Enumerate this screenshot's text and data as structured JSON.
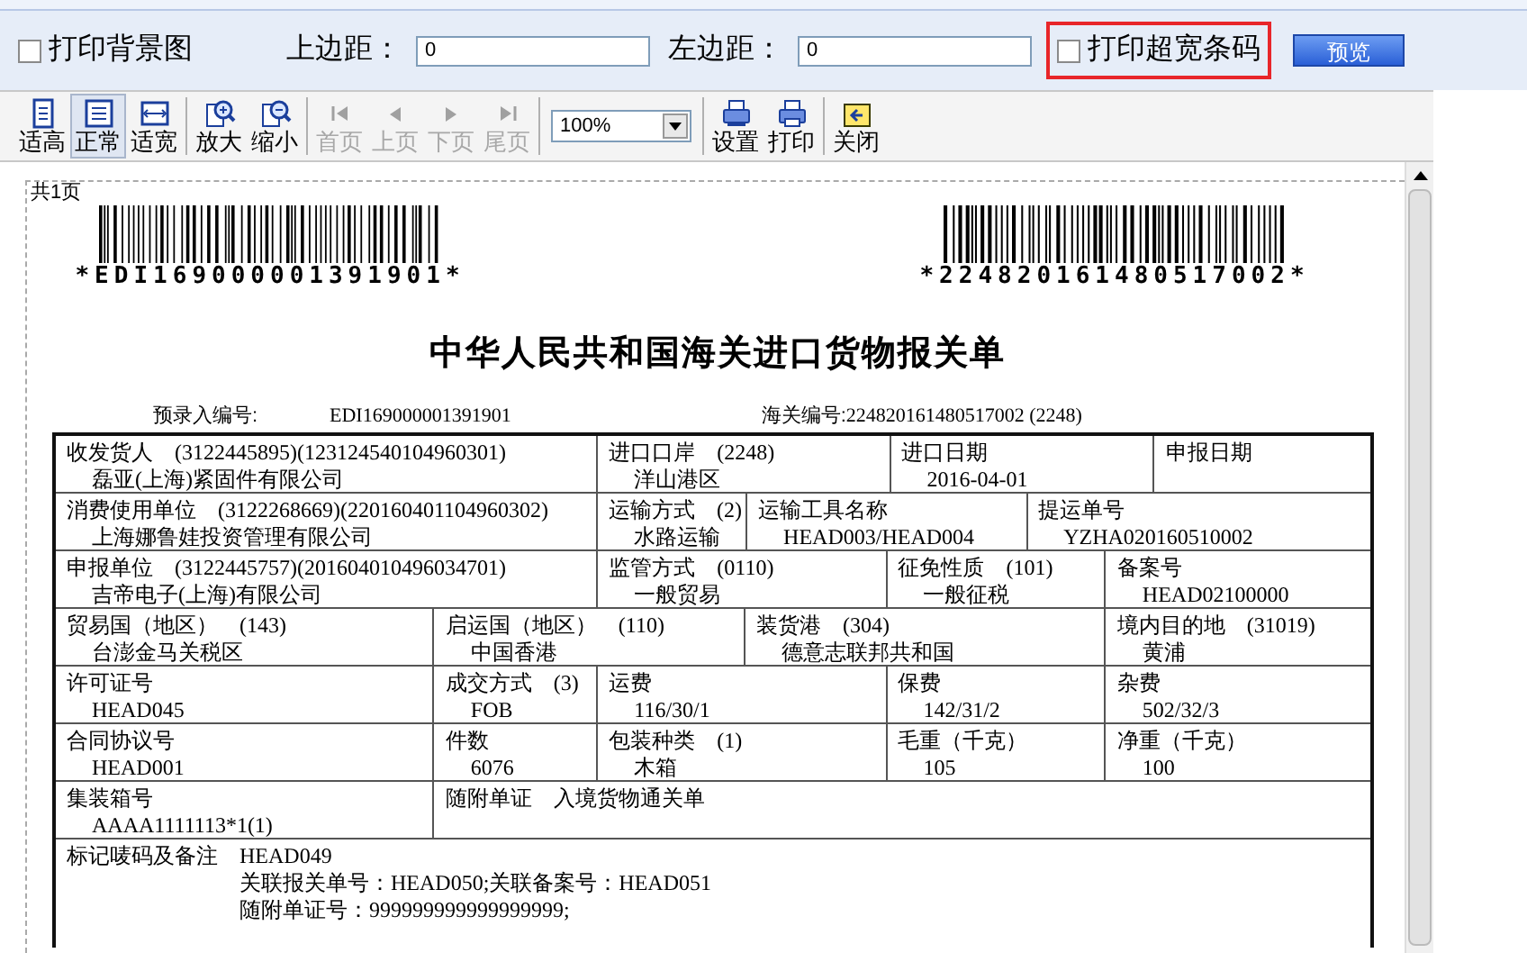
{
  "options_bar": {
    "print_background": {
      "label": "打印背景图",
      "checked": false
    },
    "top_margin": {
      "label": "上边距：",
      "value": "0"
    },
    "left_margin": {
      "label": "左边距：",
      "value": "0"
    },
    "print_wide_barcode": {
      "label": "打印超宽条码",
      "checked": false,
      "highlighted": true
    },
    "preview_button": "预览"
  },
  "toolbar": [
    {
      "kind": "fit-height",
      "label": "适高",
      "disabled": false,
      "selected": false
    },
    {
      "kind": "normal",
      "label": "正常",
      "disabled": false,
      "selected": true
    },
    {
      "kind": "fit-width",
      "label": "适宽",
      "disabled": false,
      "selected": false
    },
    {
      "kind": "separator"
    },
    {
      "kind": "zoom-in",
      "label": "放大",
      "disabled": false,
      "selected": false
    },
    {
      "kind": "zoom-out",
      "label": "缩小",
      "disabled": false,
      "selected": false
    },
    {
      "kind": "separator"
    },
    {
      "kind": "first",
      "label": "首页",
      "disabled": true,
      "selected": false
    },
    {
      "kind": "prev",
      "label": "上页",
      "disabled": true,
      "selected": false
    },
    {
      "kind": "next",
      "label": "下页",
      "disabled": true,
      "selected": false
    },
    {
      "kind": "last",
      "label": "尾页",
      "disabled": true,
      "selected": false
    },
    {
      "kind": "separator"
    },
    {
      "kind": "zoom-select",
      "value": "100%"
    },
    {
      "kind": "separator"
    },
    {
      "kind": "settings",
      "label": "设置",
      "disabled": false,
      "selected": false
    },
    {
      "kind": "print",
      "label": "打印",
      "disabled": false,
      "selected": false
    },
    {
      "kind": "separator"
    },
    {
      "kind": "close",
      "label": "关闭",
      "disabled": false,
      "selected": false
    }
  ],
  "document": {
    "page_count": "共1页",
    "barcodes": [
      "*EDI169000001391901*",
      "*224820161480517002*"
    ],
    "title": "中华人民共和国海关进口货物报关单",
    "pre_entry": {
      "label": "预录入编号:",
      "value": "EDI169000001391901"
    },
    "customs_no": {
      "label": "海关编号:",
      "value": "224820161480517002  (2248)"
    },
    "rows": [
      [
        {
          "label": "收发货人",
          "code": "(3122445895)(123124540104960301)",
          "value": "磊亚(上海)紧固件有限公司"
        },
        {
          "label": "进口口岸",
          "code": "(2248)",
          "value": "洋山港区"
        },
        {
          "label": "进口日期",
          "value": "2016-04-01"
        },
        {
          "label": "申报日期"
        }
      ],
      [
        {
          "label": "消费使用单位",
          "code": "(3122268669)(220160401104960302)",
          "value": "上海娜鲁娃投资管理有限公司"
        },
        {
          "label": "运输方式",
          "code": "(2)",
          "value": "水路运输"
        },
        {
          "label": "运输工具名称",
          "value": "HEAD003/HEAD004"
        },
        {
          "label": "提运单号",
          "value": "YZHA020160510002"
        }
      ],
      [
        {
          "label": "申报单位",
          "code": "(3122445757)(201604010496034701)",
          "value": "吉帝电子(上海)有限公司"
        },
        {
          "label": "监管方式",
          "code": "(0110)",
          "value": "一般贸易"
        },
        {
          "label": "征免性质",
          "code": "(101)",
          "value": "一般征税"
        },
        {
          "label": "备案号",
          "value": "HEAD02100000"
        }
      ],
      [
        {
          "label": "贸易国（地区）",
          "code": "(143)",
          "value": "台澎金马关税区"
        },
        {
          "label": "启运国（地区）",
          "code": "(110)",
          "value": "中国香港"
        },
        {
          "label": "装货港",
          "code": "(304)",
          "value": "德意志联邦共和国"
        },
        {
          "label": "境内目的地",
          "code": "(31019)",
          "value": "黄浦"
        }
      ],
      [
        {
          "label": "许可证号",
          "value": "HEAD045"
        },
        {
          "label": "成交方式",
          "code": "(3)",
          "value": "FOB"
        },
        {
          "label": "运费",
          "value": "116/30/1"
        },
        {
          "label": "保费",
          "value": "142/31/2"
        },
        {
          "label": "杂费",
          "value": "502/32/3"
        }
      ],
      [
        {
          "label": "合同协议号",
          "value": "HEAD001"
        },
        {
          "label": "件数",
          "value": "6076"
        },
        {
          "label": "包装种类",
          "code": "(1)",
          "value": "木箱"
        },
        {
          "label": "毛重（千克）",
          "value": "105"
        },
        {
          "label": "净重（千克）",
          "value": "100"
        }
      ],
      [
        {
          "label": "集装箱号",
          "value": "AAAA1111113*1(1)"
        },
        {
          "label": "随附单证",
          "code": "入境货物通关单"
        }
      ],
      [
        {
          "label": "标记唛码及备注",
          "code": "HEAD049",
          "lines": [
            "关联报关单号：HEAD050;关联备案号：HEAD051",
            "随附单证号：999999999999999999;"
          ]
        }
      ]
    ]
  }
}
